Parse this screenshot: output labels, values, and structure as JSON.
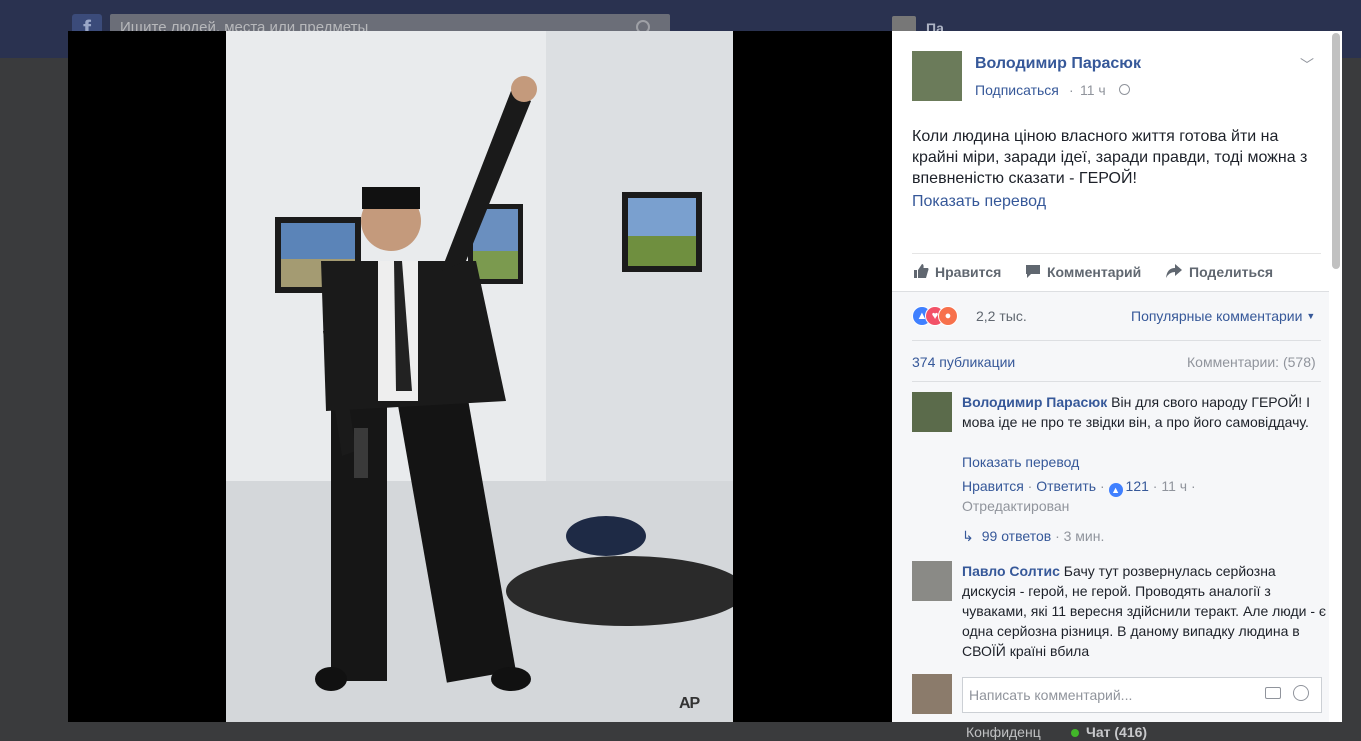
{
  "background": {
    "search_placeholder": "Ищите людей, места или предметы",
    "logo": "f",
    "username_fragment": "Па",
    "chat_fragment": "Конфиденц",
    "chat_label": "Чат (416)"
  },
  "photo": {
    "watermark": "AP"
  },
  "post": {
    "author": "Володимир Парасюк",
    "subscribe": "Подписаться",
    "separator": "·",
    "time": "11 ч",
    "text": "Коли людина ціною власного життя готова йти на крайні міри, заради ідеї, заради правди, тоді можна з впевненістю сказати - ГЕРОЙ!",
    "translate": "Показать перевод"
  },
  "actions": {
    "like": "Нравится",
    "comment": "Комментарий",
    "share": "Поделиться"
  },
  "stats": {
    "reactions": "2,2 тыс.",
    "sort": "Популярные комментарии",
    "shares": "374 публикации",
    "comments": "Комментарии: (578)"
  },
  "comments": [
    {
      "author": "Володимир Парасюк",
      "text": "Він для свого народу ГЕРОЙ! І мова іде не про те звідки він, а про його самовіддачу.",
      "translate": "Показать перевод",
      "like": "Нравится",
      "dot": "·",
      "reply": "Ответить",
      "likes": "121",
      "time": "11 ч",
      "edited": "Отредактирован",
      "replies": "99 ответов",
      "replies_time": "3 мин."
    },
    {
      "author": "Павло Солтис",
      "text": "Бачу тут розвернулась серйозна дискусія - герой, не герой. Проводять аналогії з чуваками, які 11 вересня здійснили теракт. Але люди - є одна серйозна різниця. В даному випадку людина в СВОЇЙ країні вбила"
    }
  ],
  "comment_box": {
    "placeholder": "Написать комментарий..."
  },
  "colors": {
    "link": "#365899",
    "like_blue": "#4080ff",
    "love_red": "#f25268",
    "angry_orange": "#f7714c"
  }
}
